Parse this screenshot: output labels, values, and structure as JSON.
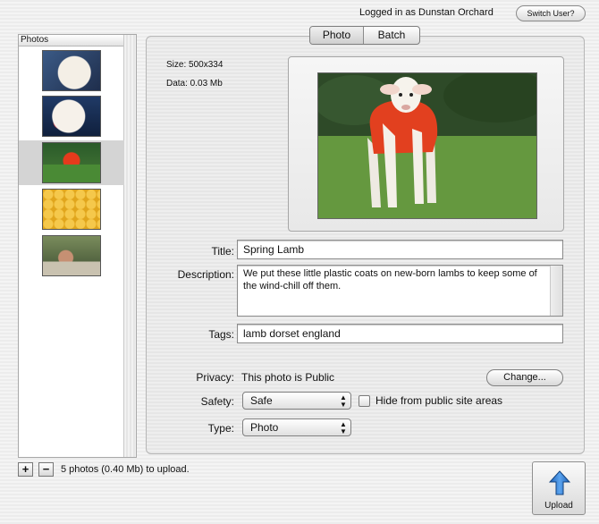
{
  "header": {
    "login_text": "Logged in as Dunstan Orchard",
    "switch_user_label": "Switch User?"
  },
  "photos_panel": {
    "header": "Photos",
    "items": [
      {
        "subject": "bulldog"
      },
      {
        "subject": "dog-face"
      },
      {
        "subject": "lamb",
        "selected": true
      },
      {
        "subject": "yellow-pattern"
      },
      {
        "subject": "person"
      }
    ]
  },
  "footer": {
    "add_symbol": "+",
    "remove_symbol": "−",
    "summary": "5 photos (0.40 Mb) to upload.",
    "upload_label": "Upload"
  },
  "tabs": {
    "photo": "Photo",
    "batch": "Batch"
  },
  "info": {
    "size": "Size:  500x334",
    "data": "Data:  0.03 Mb"
  },
  "form": {
    "title_label": "Title:",
    "title_value": "Spring Lamb",
    "description_label": "Description:",
    "description_value": "We put these little plastic coats on new-born lambs to keep some of the wind-chill off them.",
    "tags_label": "Tags:",
    "tags_value": "lamb dorset england",
    "privacy_label": "Privacy:",
    "privacy_value": "This photo is Public",
    "change_label": "Change...",
    "safety_label": "Safety:",
    "safety_value": "Safe",
    "hide_label": "Hide from public site areas",
    "type_label": "Type:",
    "type_value": "Photo"
  },
  "colors": {
    "upload_arrow": "#2f7fd6",
    "selection": "#d4d4d4"
  }
}
